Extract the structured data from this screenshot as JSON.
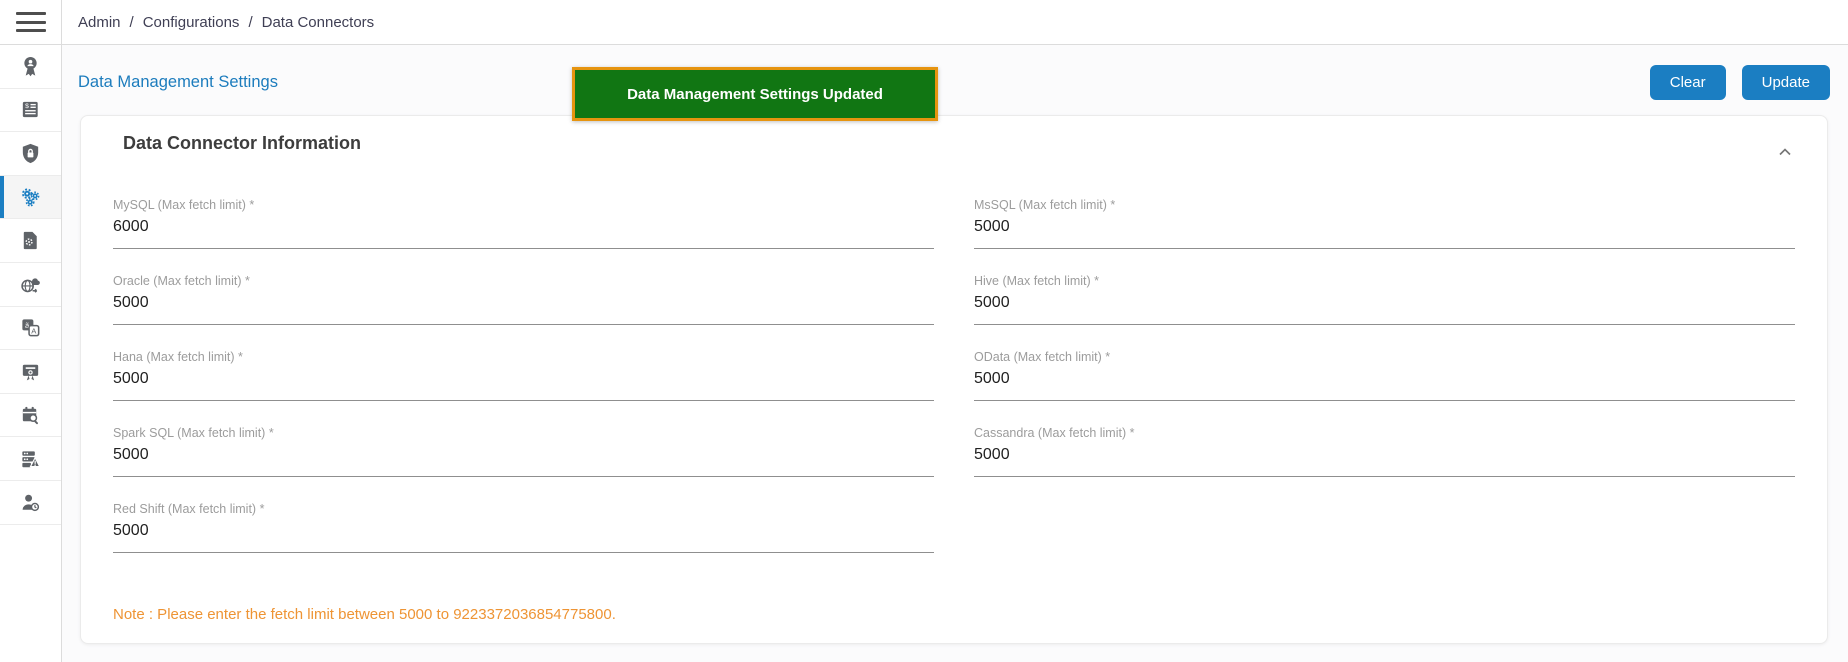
{
  "topbar": {
    "breadcrumb": [
      {
        "label": "Admin"
      },
      {
        "label": "Configurations"
      },
      {
        "label": "Data Connectors"
      }
    ],
    "separator": "/"
  },
  "sidebar": {
    "icons": [
      "user-award-icon",
      "billing-invoice-icon",
      "security-shield-icon",
      "configurations-gears-icon",
      "file-settings-icon",
      "data-transfer-globe-icon",
      "translation-icon",
      "certificate-icon",
      "schedule-search-icon",
      "server-alert-icon",
      "user-activity-icon"
    ],
    "active_index": 3
  },
  "page": {
    "title": "Data Management Settings",
    "toast": {
      "message": "Data Management Settings Updated"
    },
    "actions": {
      "clear": "Clear",
      "update": "Update"
    },
    "card": {
      "title": "Data Connector Information",
      "fields": [
        {
          "label": "MySQL (Max fetch limit) *",
          "value": "6000"
        },
        {
          "label": "MsSQL (Max fetch limit) *",
          "value": "5000"
        },
        {
          "label": "Oracle (Max fetch limit) *",
          "value": "5000"
        },
        {
          "label": "Hive (Max fetch limit) *",
          "value": "5000"
        },
        {
          "label": "Hana (Max fetch limit) *",
          "value": "5000"
        },
        {
          "label": "OData (Max fetch limit) *",
          "value": "5000"
        },
        {
          "label": "Spark SQL (Max fetch limit) *",
          "value": "5000"
        },
        {
          "label": "Cassandra (Max fetch limit) *",
          "value": "5000"
        },
        {
          "label": "Red Shift (Max fetch limit) *",
          "value": "5000"
        }
      ],
      "note": "Note : Please enter the fetch limit between 5000 to 9223372036854775800."
    },
    "colors": {
      "accent": "#1b7ec2",
      "toast_bg": "#117613",
      "toast_border": "#e6940f",
      "note": "#ee9434"
    }
  }
}
